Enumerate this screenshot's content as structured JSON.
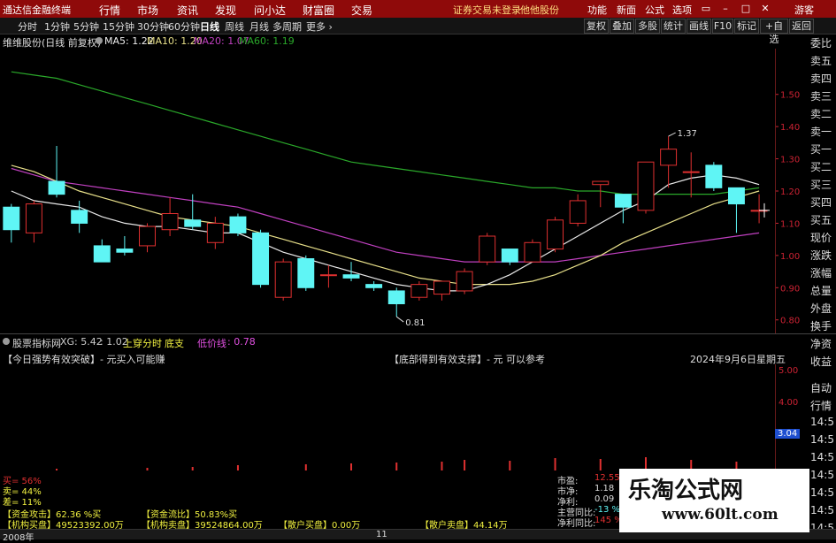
{
  "app": {
    "title": "通达信金融终端"
  },
  "menu": {
    "items": [
      "行情",
      "市场",
      "资讯",
      "发现",
      "问小达",
      "财富圈",
      "交易"
    ]
  },
  "notice": {
    "text": "证券交易未登录",
    "broker": "他他股份"
  },
  "toolbar_right": {
    "items": [
      "功能",
      "新面",
      "公式",
      "选项"
    ],
    "guest": "游客"
  },
  "periods": [
    "分时",
    "1分钟",
    "5分钟",
    "15分钟",
    "30分钟",
    "60分钟",
    "日线",
    "周线",
    "月线",
    "多周期",
    "更多"
  ],
  "active_period": "日线",
  "right_tools": [
    "复权",
    "叠加",
    "多股",
    "统计",
    "画线",
    "F10",
    "标记",
    "+自选",
    "返回"
  ],
  "legend": {
    "stock": "维维股份(日线 前复权)",
    "ma5": "MA5: 1.22",
    "ma10": "MA10: 1.20",
    "ma20": "MA20: 1.07",
    "ma60": "MA60: 1.19"
  },
  "colors": {
    "up": "#e03030",
    "down": "#5ff5f5",
    "ma5": "#e8e8e8",
    "ma10": "#e8e08a",
    "ma20": "#c040c0",
    "ma60": "#2aa82a"
  },
  "chart_data": {
    "type": "candlestick",
    "ylim": [
      0.78,
      1.62
    ],
    "y_ticks": [
      "1.50",
      "1.40",
      "1.30",
      "1.20",
      "1.10",
      "1.00",
      "0.90",
      "0.80"
    ],
    "candles": [
      {
        "o": 1.15,
        "c": 1.08,
        "h": 1.16,
        "l": 1.04
      },
      {
        "o": 1.07,
        "c": 1.16,
        "h": 1.17,
        "l": 1.04
      },
      {
        "o": 1.23,
        "c": 1.19,
        "h": 1.34,
        "l": 1.18
      },
      {
        "o": 1.14,
        "c": 1.1,
        "h": 1.17,
        "l": 1.07
      },
      {
        "o": 1.03,
        "c": 0.98,
        "h": 1.05,
        "l": 0.98
      },
      {
        "o": 1.02,
        "c": 1.01,
        "h": 1.06,
        "l": 1.0
      },
      {
        "o": 1.03,
        "c": 1.09,
        "h": 1.1,
        "l": 1.01
      },
      {
        "o": 1.08,
        "c": 1.13,
        "h": 1.18,
        "l": 1.06
      },
      {
        "o": 1.11,
        "c": 1.09,
        "h": 1.19,
        "l": 1.08
      },
      {
        "o": 1.04,
        "c": 1.1,
        "h": 1.12,
        "l": 1.02
      },
      {
        "o": 1.12,
        "c": 1.07,
        "h": 1.13,
        "l": 1.06
      },
      {
        "o": 1.07,
        "c": 0.91,
        "h": 1.08,
        "l": 0.9
      },
      {
        "o": 0.87,
        "c": 0.98,
        "h": 0.99,
        "l": 0.86
      },
      {
        "o": 0.99,
        "c": 0.9,
        "h": 1.0,
        "l": 0.89
      },
      {
        "o": 0.94,
        "c": 0.94,
        "h": 0.97,
        "l": 0.9
      },
      {
        "o": 0.94,
        "c": 0.93,
        "h": 0.98,
        "l": 0.92
      },
      {
        "o": 0.91,
        "c": 0.9,
        "h": 0.92,
        "l": 0.89
      },
      {
        "o": 0.89,
        "c": 0.85,
        "h": 0.9,
        "l": 0.81
      },
      {
        "o": 0.87,
        "c": 0.91,
        "h": 0.92,
        "l": 0.86
      },
      {
        "o": 0.88,
        "c": 0.92,
        "h": 0.92,
        "l": 0.86
      },
      {
        "o": 0.89,
        "c": 0.95,
        "h": 0.96,
        "l": 0.88
      },
      {
        "o": 0.98,
        "c": 1.06,
        "h": 1.07,
        "l": 0.97
      },
      {
        "o": 1.02,
        "c": 0.98,
        "h": 1.02,
        "l": 0.97
      },
      {
        "o": 0.98,
        "c": 1.04,
        "h": 1.05,
        "l": 0.98
      },
      {
        "o": 1.02,
        "c": 1.11,
        "h": 1.12,
        "l": 1.01
      },
      {
        "o": 1.1,
        "c": 1.17,
        "h": 1.19,
        "l": 1.09
      },
      {
        "o": 1.22,
        "c": 1.23,
        "h": 1.23,
        "l": 1.15
      },
      {
        "o": 1.19,
        "c": 1.15,
        "h": 1.19,
        "l": 1.1
      },
      {
        "o": 1.14,
        "c": 1.29,
        "h": 1.29,
        "l": 1.13
      },
      {
        "o": 1.28,
        "c": 1.33,
        "h": 1.37,
        "l": 1.21
      },
      {
        "o": 1.26,
        "c": 1.26,
        "h": 1.32,
        "l": 1.18
      },
      {
        "o": 1.28,
        "c": 1.21,
        "h": 1.29,
        "l": 1.2
      },
      {
        "o": 1.21,
        "c": 1.16,
        "h": 1.21,
        "l": 1.07
      },
      {
        "o": 1.14,
        "c": 1.14,
        "h": 1.19,
        "l": 1.1
      }
    ],
    "ma5": [
      1.2,
      1.17,
      1.16,
      1.15,
      1.12,
      1.1,
      1.09,
      1.09,
      1.08,
      1.07,
      1.07,
      1.04,
      1.01,
      0.99,
      0.97,
      0.95,
      0.93,
      0.91,
      0.9,
      0.89,
      0.89,
      0.91,
      0.94,
      0.98,
      1.02,
      1.06,
      1.1,
      1.14,
      1.17,
      1.22,
      1.24,
      1.25,
      1.24,
      1.22
    ],
    "ma10": [
      1.28,
      1.26,
      1.23,
      1.2,
      1.18,
      1.16,
      1.14,
      1.12,
      1.11,
      1.1,
      1.09,
      1.07,
      1.05,
      1.03,
      1.01,
      0.99,
      0.97,
      0.95,
      0.93,
      0.92,
      0.91,
      0.91,
      0.91,
      0.92,
      0.94,
      0.97,
      1.0,
      1.04,
      1.07,
      1.1,
      1.13,
      1.16,
      1.18,
      1.2
    ],
    "ma20": [
      1.27,
      1.25,
      1.23,
      1.22,
      1.21,
      1.2,
      1.19,
      1.18,
      1.17,
      1.16,
      1.15,
      1.13,
      1.11,
      1.09,
      1.07,
      1.05,
      1.03,
      1.01,
      1.0,
      0.99,
      0.98,
      0.98,
      0.98,
      0.98,
      0.98,
      0.99,
      1.0,
      1.01,
      1.02,
      1.03,
      1.04,
      1.05,
      1.06,
      1.07
    ],
    "ma60": [
      1.57,
      1.56,
      1.55,
      1.53,
      1.51,
      1.49,
      1.47,
      1.45,
      1.43,
      1.41,
      1.39,
      1.37,
      1.35,
      1.33,
      1.31,
      1.29,
      1.28,
      1.27,
      1.26,
      1.25,
      1.24,
      1.23,
      1.22,
      1.21,
      1.21,
      1.2,
      1.2,
      1.19,
      1.19,
      1.19,
      1.19,
      1.19,
      1.2,
      1.21
    ],
    "annotations": [
      {
        "label": "1.37",
        "candle": 29
      },
      {
        "label": "0.81",
        "candle": 17
      }
    ]
  },
  "indicator": {
    "name": "股票指标网",
    "xg": "XG: 5.42",
    "v1": ": 1.02",
    "l1": "上穿分时",
    "l2": "底支",
    "l3": "低价线",
    "v3": ": 0.78",
    "left_msg": "【今日强势有效突破】- 元买入可能赚",
    "mid_msg": "【底部得到有效支撑】- 元 可以参考",
    "date": "2024年9月6日星期五",
    "y_ticks": [
      "5.00",
      "4.00",
      "3.04"
    ]
  },
  "right_column": {
    "items": [
      "委比",
      "卖五",
      "卖四",
      "卖三",
      "卖二",
      "卖一",
      "买一",
      "买二",
      "买三",
      "买四",
      "买五",
      "现价",
      "涨跌",
      "涨幅",
      "总量",
      "外盘",
      "换手",
      "净资",
      "收益",
      "自动",
      "行情",
      "14:5",
      "14:5",
      "14:5",
      "14:5",
      "14:5",
      "14:5",
      "14:5"
    ]
  },
  "bottom": {
    "buy_pct": "买= 56%",
    "sell_pct": "卖= 44%",
    "diff_pct": "差= 11%",
    "fund_attack": "【资金攻击】62.36 %买",
    "fund_flow": "【资金流比】50.83%买",
    "inst_buy": "【机构买盘】49523392.00万",
    "inst_sell": "【机构卖盘】39524864.00万",
    "retail_buy": "【散户买盘】0.00万",
    "retail_sell": "【散户卖盘】44.14万",
    "pe_label": "市盈:",
    "pe_val": "12.55",
    "pb_label": "市净:",
    "pb_val": "1.18",
    "profit_label": "净利:",
    "profit_val": "0.09",
    "ratio_label": "主营同比:",
    "ratio_val": "-13 %",
    "net_ratio_label": "净利同比:",
    "net_ratio_val": "145 %",
    "year": "2008年",
    "page": "11"
  },
  "watermark": {
    "title": "乐淘公式网",
    "url": "www.60lt.com"
  }
}
